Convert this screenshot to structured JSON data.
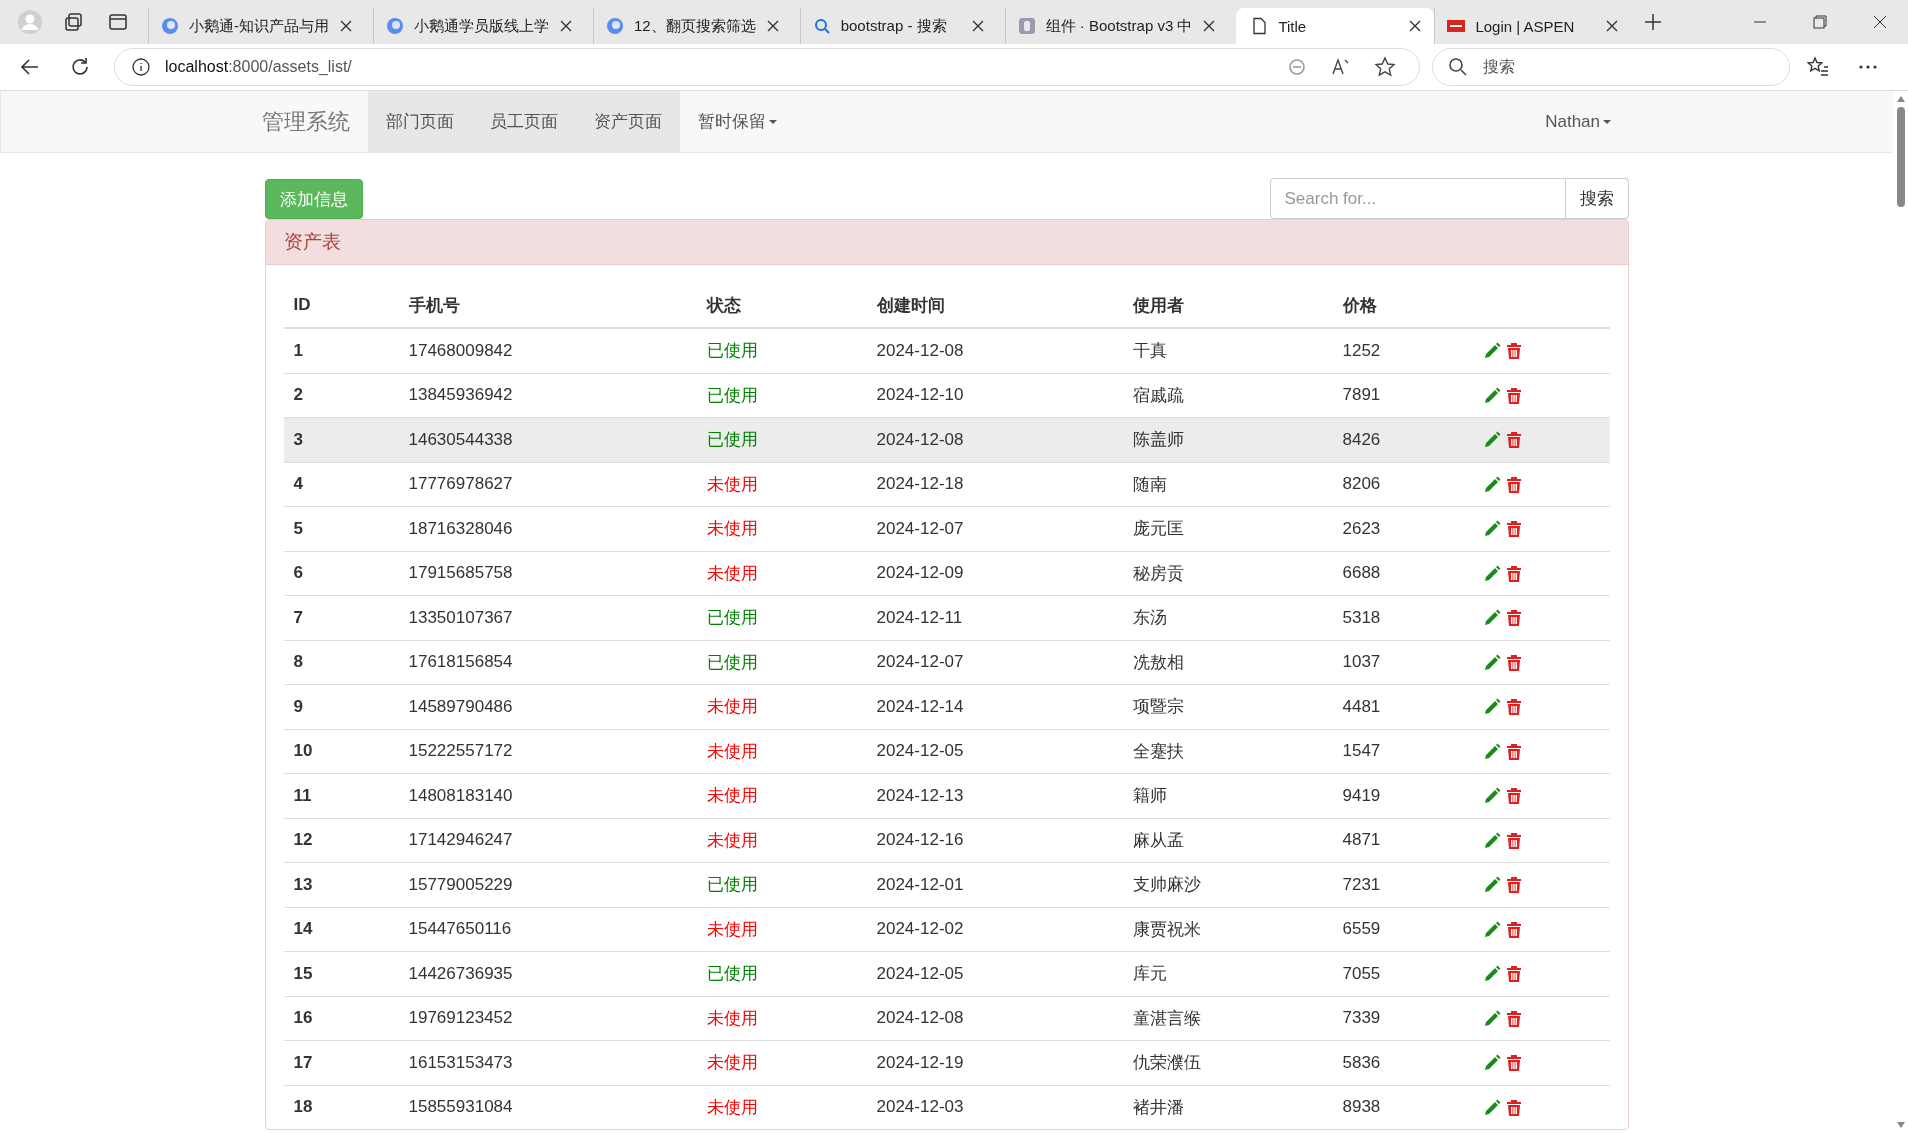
{
  "browser": {
    "tabs": [
      {
        "title": "小鹅通-知识产品与用",
        "kind": "swirl",
        "selected": false
      },
      {
        "title": "小鹅通学员版线上学",
        "kind": "swirl",
        "selected": false
      },
      {
        "title": "12、翻页搜索筛选",
        "kind": "swirl",
        "selected": false
      },
      {
        "title": "bootstrap - 搜索",
        "kind": "search",
        "selected": false
      },
      {
        "title": "组件 · Bootstrap v3 中",
        "kind": "square",
        "selected": false
      },
      {
        "title": "Title",
        "kind": "page",
        "selected": true
      },
      {
        "title": "Login | ASPEN",
        "kind": "red",
        "selected": false
      }
    ],
    "url_host": "localhost",
    "url_rest": ":8000/assets_list/",
    "search_placeholder": "搜索"
  },
  "navbar": {
    "brand": "管理系统",
    "items": [
      {
        "label": "部门页面",
        "selected": true,
        "dropdown": false
      },
      {
        "label": "员工页面",
        "selected": true,
        "dropdown": false
      },
      {
        "label": "资产页面",
        "selected": true,
        "dropdown": false
      },
      {
        "label": "暂时保留",
        "selected": false,
        "dropdown": true
      }
    ],
    "user": "Nathan"
  },
  "add_button": "添加信息",
  "search": {
    "placeholder": "Search for...",
    "button": "搜索"
  },
  "panel": {
    "title": "资产表",
    "table": {
      "columns": [
        "ID",
        "手机号",
        "状态",
        "创建时间",
        "使用者",
        "价格"
      ],
      "rows": [
        {
          "id": "1",
          "phone": "17468009842",
          "status": "已使用",
          "used": true,
          "date": "2024-12-08",
          "user": "干真",
          "price": "1252",
          "highlighted": false
        },
        {
          "id": "2",
          "phone": "13845936942",
          "status": "已使用",
          "used": true,
          "date": "2024-12-10",
          "user": "宿戚疏",
          "price": "7891",
          "highlighted": false
        },
        {
          "id": "3",
          "phone": "14630544338",
          "status": "已使用",
          "used": true,
          "date": "2024-12-08",
          "user": "陈盖师",
          "price": "8426",
          "highlighted": true
        },
        {
          "id": "4",
          "phone": "17776978627",
          "status": "未使用",
          "used": false,
          "date": "2024-12-18",
          "user": "随南",
          "price": "8206",
          "highlighted": false
        },
        {
          "id": "5",
          "phone": "18716328046",
          "status": "未使用",
          "used": false,
          "date": "2024-12-07",
          "user": "庞元匡",
          "price": "2623",
          "highlighted": false
        },
        {
          "id": "6",
          "phone": "17915685758",
          "status": "未使用",
          "used": false,
          "date": "2024-12-09",
          "user": "秘房贡",
          "price": "6688",
          "highlighted": false
        },
        {
          "id": "7",
          "phone": "13350107367",
          "status": "已使用",
          "used": true,
          "date": "2024-12-11",
          "user": "东汤",
          "price": "5318",
          "highlighted": false
        },
        {
          "id": "8",
          "phone": "17618156854",
          "status": "已使用",
          "used": true,
          "date": "2024-12-07",
          "user": "冼敖相",
          "price": "1037",
          "highlighted": false
        },
        {
          "id": "9",
          "phone": "14589790486",
          "status": "未使用",
          "used": false,
          "date": "2024-12-14",
          "user": "项暨宗",
          "price": "4481",
          "highlighted": false
        },
        {
          "id": "10",
          "phone": "15222557172",
          "status": "未使用",
          "used": false,
          "date": "2024-12-05",
          "user": "全蹇扶",
          "price": "1547",
          "highlighted": false
        },
        {
          "id": "11",
          "phone": "14808183140",
          "status": "未使用",
          "used": false,
          "date": "2024-12-13",
          "user": "籍师",
          "price": "9419",
          "highlighted": false
        },
        {
          "id": "12",
          "phone": "17142946247",
          "status": "未使用",
          "used": false,
          "date": "2024-12-16",
          "user": "麻从孟",
          "price": "4871",
          "highlighted": false
        },
        {
          "id": "13",
          "phone": "15779005229",
          "status": "已使用",
          "used": true,
          "date": "2024-12-01",
          "user": "支帅麻沙",
          "price": "7231",
          "highlighted": false
        },
        {
          "id": "14",
          "phone": "15447650116",
          "status": "未使用",
          "used": false,
          "date": "2024-12-02",
          "user": "康贾祝米",
          "price": "6559",
          "highlighted": false
        },
        {
          "id": "15",
          "phone": "14426736935",
          "status": "已使用",
          "used": true,
          "date": "2024-12-05",
          "user": "库元",
          "price": "7055",
          "highlighted": false
        },
        {
          "id": "16",
          "phone": "19769123452",
          "status": "未使用",
          "used": false,
          "date": "2024-12-08",
          "user": "童湛言缑",
          "price": "7339",
          "highlighted": false
        },
        {
          "id": "17",
          "phone": "16153153473",
          "status": "未使用",
          "used": false,
          "date": "2024-12-19",
          "user": "仇荣濮伍",
          "price": "5836",
          "highlighted": false
        },
        {
          "id": "18",
          "phone": "15855931084",
          "status": "未使用",
          "used": false,
          "date": "2024-12-03",
          "user": "褚井潘",
          "price": "8938",
          "highlighted": false
        }
      ]
    }
  }
}
